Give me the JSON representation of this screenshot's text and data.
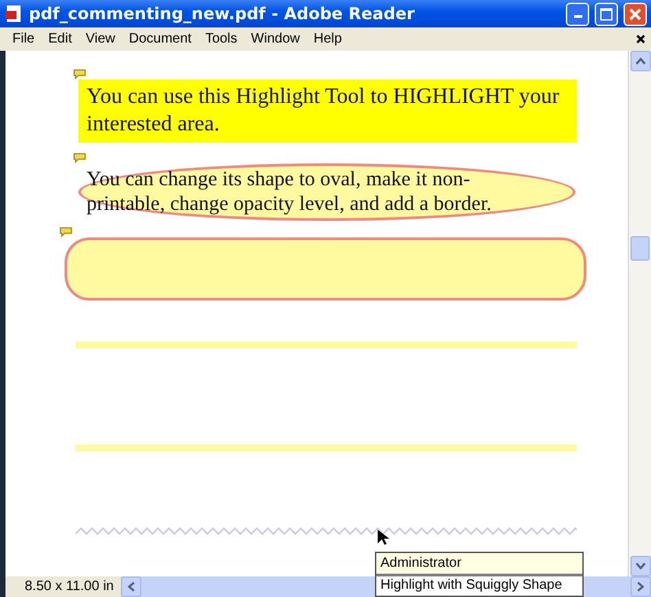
{
  "window": {
    "title": "pdf_commenting_new.pdf - Adobe Reader"
  },
  "menu": [
    "File",
    "Edit",
    "View",
    "Document",
    "Tools",
    "Window",
    "Help"
  ],
  "annotations": [
    {
      "kind": "highlight",
      "comment": true,
      "text": "You can use this Highlight Tool to HIGHLIGHT your interested area."
    },
    {
      "kind": "oval",
      "comment": true,
      "text": "You can change its shape to oval, make it non-printable, change opacity level,  and add a border."
    },
    {
      "kind": "rounded",
      "comment": true
    },
    {
      "kind": "line"
    },
    {
      "kind": "line"
    },
    {
      "kind": "squiggly"
    }
  ],
  "status_bar": {
    "page_size": "8.50 x 11.00 in"
  },
  "tooltip": {
    "author": "Administrator",
    "text": "Highlight with Squiggly Shape"
  }
}
